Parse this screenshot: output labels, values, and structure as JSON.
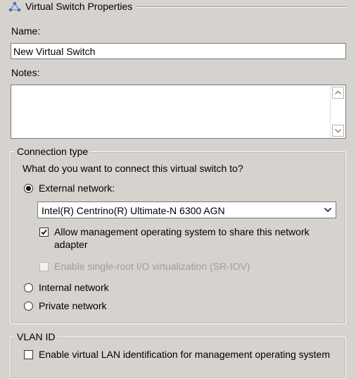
{
  "header": {
    "title": "Virtual Switch Properties",
    "icon": "virtual-switch-icon"
  },
  "name": {
    "label": "Name:",
    "value": "New Virtual Switch"
  },
  "notes": {
    "label": "Notes:",
    "value": ""
  },
  "connection_type": {
    "group_label": "Connection type",
    "question": "What do you want to connect this virtual switch to?",
    "external_label": "External network:",
    "external_selected": true,
    "adapter_value": "Intel(R) Centrino(R) Ultimate-N 6300 AGN",
    "allow_mgmt_label_line1": "Allow management operating system to share this network",
    "allow_mgmt_label_line2": "adapter",
    "allow_mgmt_checked": true,
    "sriov_label": "Enable single-root I/O virtualization (SR-IOV)",
    "sriov_checked": false,
    "sriov_enabled": false,
    "internal_label": "Internal network",
    "private_label": "Private network"
  },
  "vlan": {
    "group_label": "VLAN ID",
    "enable_label": "Enable virtual LAN identification for management operating system",
    "enable_checked": false
  }
}
